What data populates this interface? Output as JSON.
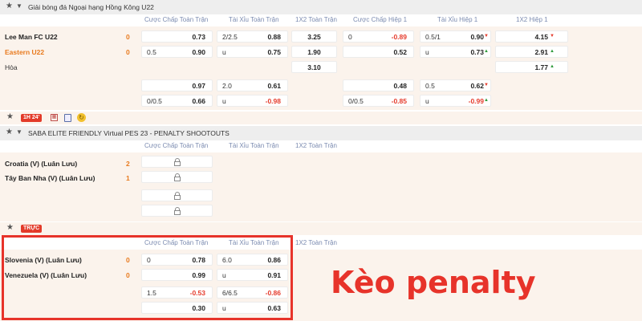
{
  "columns": {
    "hdp_full": "Cược Chấp Toàn Trận",
    "ou_full": "Tài Xỉu Toàn Trận",
    "x12_full": "1X2 Toàn Trận",
    "hdp_half": "Cược Chấp Hiệp 1",
    "ou_half": "Tài Xỉu Hiệp 1",
    "x12_half": "1X2 Hiệp 1"
  },
  "league1": {
    "name": "Giải bóng đá Ngoại hạng Hồng Kông U22",
    "home": "Lee Man FC U22",
    "home_score": "0",
    "away": "Eastern U22",
    "away_score": "0",
    "draw": "Hòa",
    "r1": {
      "hdp_l": "",
      "hdp_r": "0.73",
      "ou_l": "2/2.5",
      "ou_r": "0.88",
      "x12": "3.25",
      "hh_l": "0",
      "hh_r": "-0.89",
      "ouh_l": "0.5/1",
      "ouh_r": "0.90",
      "x12h": "4.15"
    },
    "r2": {
      "hdp_l": "0.5",
      "hdp_r": "0.90",
      "ou_l": "u",
      "ou_r": "0.75",
      "x12": "1.90",
      "hh_l": "",
      "hh_r": "0.52",
      "ouh_l": "u",
      "ouh_r": "0.73",
      "x12h": "2.91"
    },
    "r3": {
      "x12": "3.10",
      "x12h": "1.77"
    },
    "r4": {
      "hdp_l": "",
      "hdp_r": "0.97",
      "ou_l": "2.0",
      "ou_r": "0.61",
      "hh_l": "",
      "hh_r": "0.48",
      "ouh_l": "0.5",
      "ouh_r": "0.62"
    },
    "r5": {
      "hdp_l": "0/0.5",
      "hdp_r": "0.66",
      "ou_l": "u",
      "ou_r": "-0.98",
      "hh_l": "0/0.5",
      "hh_r": "-0.85",
      "ouh_l": "u",
      "ouh_r": "-0.99"
    },
    "time": "1H 24'"
  },
  "league2": {
    "name": "SABA ELITE FRIENDLY Virtual PES 23 - PENALTY SHOOTOUTS",
    "home": "Croatia (V) (Luân Lưu)",
    "home_score": "2",
    "away": "Tây Ban Nha (V) (Luân Lưu)",
    "away_score": "1"
  },
  "live_label": "TRỰC",
  "league3": {
    "home": "Slovenia (V) (Luân Lưu)",
    "home_score": "0",
    "away": "Venezuela (V) (Luân Lưu)",
    "away_score": "0",
    "r1": {
      "hdp_l": "0",
      "hdp_r": "0.78",
      "ou_l": "6.0",
      "ou_r": "0.86"
    },
    "r2": {
      "hdp_l": "",
      "hdp_r": "0.99",
      "ou_l": "u",
      "ou_r": "0.91"
    },
    "r3": {
      "hdp_l": "1.5",
      "hdp_r": "-0.53",
      "ou_l": "6/6.5",
      "ou_r": "-0.86"
    },
    "r4": {
      "hdp_l": "",
      "hdp_r": "0.30",
      "ou_l": "u",
      "ou_r": "0.63"
    }
  },
  "callout": "Kèo penalty",
  "colors": {
    "accent": "#e7332a",
    "orange": "#e87a1e",
    "header_text": "#7b8bb0"
  }
}
